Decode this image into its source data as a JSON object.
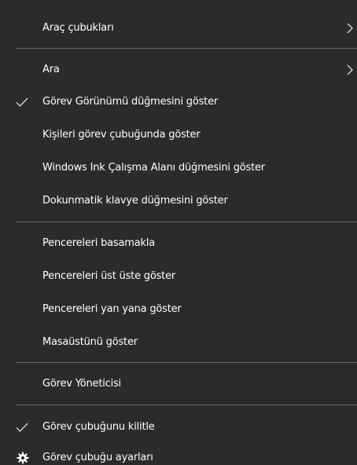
{
  "menu": {
    "items": [
      {
        "label": "Araç çubukları"
      },
      {
        "label": "Ara"
      },
      {
        "label": "Görev Görünümü düğmesini göster"
      },
      {
        "label": "Kişileri görev çubuğunda göster"
      },
      {
        "label": "Windows Ink Çalışma Alanı düğmesini göster"
      },
      {
        "label": "Dokunmatik klavye düğmesini göster"
      },
      {
        "label": "Pencereleri basamakla"
      },
      {
        "label": "Pencereleri üst üste göster"
      },
      {
        "label": "Pencereleri yan yana göster"
      },
      {
        "label": "Masaüstünü göster"
      },
      {
        "label": "Görev Yöneticisi"
      },
      {
        "label": "Görev çubuğunu kilitle"
      },
      {
        "label": "Görev çubuğu ayarları"
      }
    ],
    "checked": {
      "show_task_view_button": true,
      "lock_taskbar": true
    },
    "icons": {
      "submenu": "chevron-right-icon",
      "check": "checkmark-icon",
      "settings": "gear-icon"
    },
    "colors": {
      "background": "#2b2b2b",
      "text": "#ffffff",
      "separator": "#6a6a6a"
    }
  }
}
